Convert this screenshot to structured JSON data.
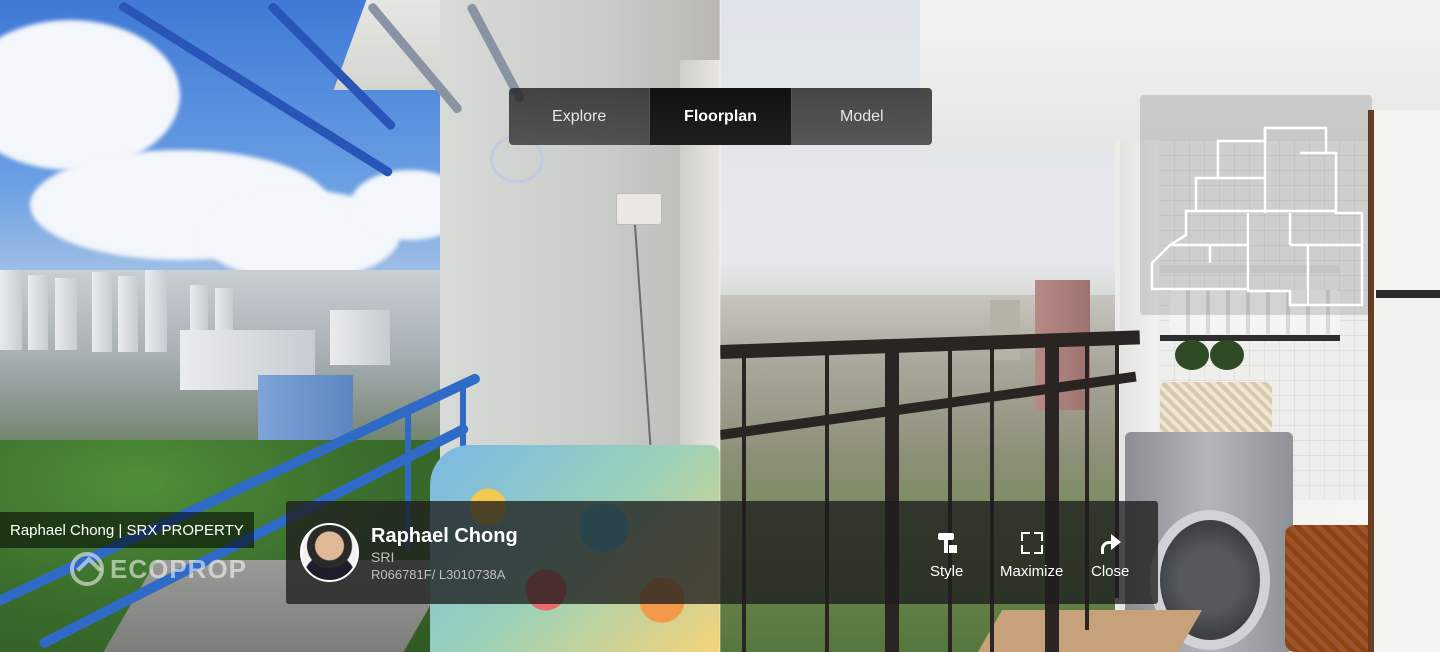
{
  "tabs": [
    {
      "label": "Explore",
      "active": false
    },
    {
      "label": "Floorplan",
      "active": true
    },
    {
      "label": "Model",
      "active": false
    }
  ],
  "watermark": {
    "credit": "Raphael Chong | SRX PROPERTY",
    "logo_text": "ECOPROP"
  },
  "agent": {
    "name": "Raphael Chong",
    "agency": "SRI",
    "license": "R066781F/ L3010738A"
  },
  "controls": {
    "style_label": "Style",
    "maximize_label": "Maximize",
    "close_label": "Close"
  },
  "icons": [
    "style-icon",
    "maximize-icon",
    "close-icon",
    "floorplan-minimap-icon",
    "avatar"
  ],
  "colors": {
    "toolbar_bg": "#2b2b2b",
    "active_tab_bg": "#151515",
    "agent_bar_bg": "#1e1e1e",
    "text_primary": "#ffffff",
    "text_secondary": "#bfbfbf"
  }
}
